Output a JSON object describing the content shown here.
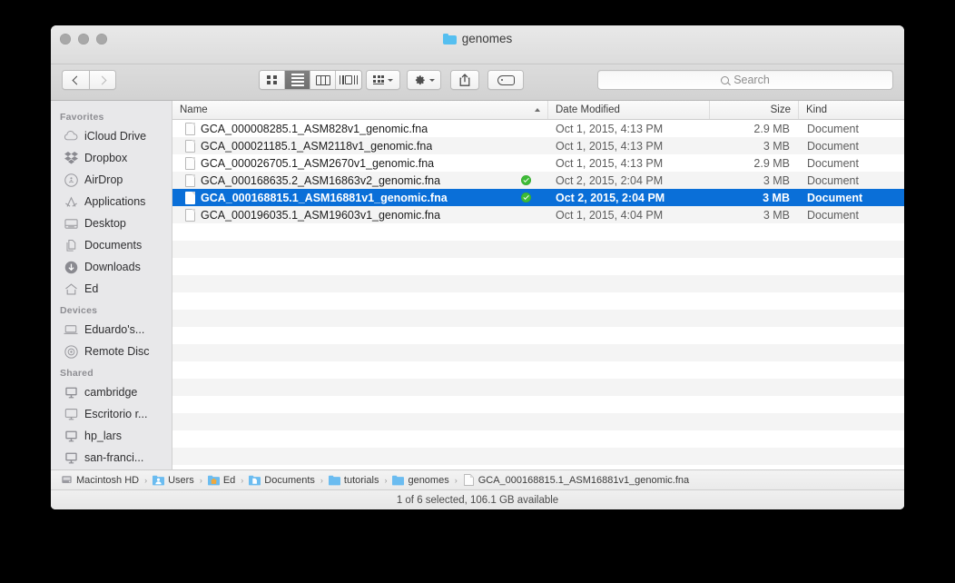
{
  "window": {
    "title": "genomes",
    "traffic_lights": [
      "close-button",
      "minimize-button",
      "zoom-button"
    ]
  },
  "toolbar": {
    "back_label": "Back",
    "forward_label": "Forward",
    "terminal_folder_label": ">_...",
    "view_modes": [
      {
        "name": "icon-view",
        "selected": false
      },
      {
        "name": "list-view",
        "selected": true
      },
      {
        "name": "column-view",
        "selected": false
      },
      {
        "name": "coverflow-view",
        "selected": false
      }
    ],
    "arrange_label": "Arrange",
    "action_label": "Action",
    "share_label": "Share",
    "tag_label": "Edit Tags"
  },
  "search": {
    "placeholder": "Search",
    "value": ""
  },
  "sidebar": {
    "sections": [
      {
        "title": "Favorites",
        "items": [
          {
            "label": "iCloud Drive",
            "icon": "cloud-icon"
          },
          {
            "label": "Dropbox",
            "icon": "dropbox-icon"
          },
          {
            "label": "AirDrop",
            "icon": "airdrop-icon"
          },
          {
            "label": "Applications",
            "icon": "applications-icon"
          },
          {
            "label": "Desktop",
            "icon": "desktop-icon"
          },
          {
            "label": "Documents",
            "icon": "documents-icon"
          },
          {
            "label": "Downloads",
            "icon": "downloads-icon"
          },
          {
            "label": "Ed",
            "icon": "home-icon"
          }
        ]
      },
      {
        "title": "Devices",
        "items": [
          {
            "label": "Eduardo's...",
            "icon": "laptop-icon"
          },
          {
            "label": "Remote Disc",
            "icon": "disc-icon"
          }
        ]
      },
      {
        "title": "Shared",
        "items": [
          {
            "label": "cambridge",
            "icon": "display-icon"
          },
          {
            "label": "Escritorio r...",
            "icon": "display-icon"
          },
          {
            "label": "hp_lars",
            "icon": "display-icon"
          },
          {
            "label": "san-franci...",
            "icon": "display-icon"
          }
        ]
      }
    ]
  },
  "file_list": {
    "columns": [
      "Name",
      "Date Modified",
      "Size",
      "Kind"
    ],
    "sort_column": "Name",
    "sort_direction": "ascending",
    "rows": [
      {
        "name": "GCA_000008285.1_ASM828v1_genomic.fna",
        "date": "Oct 1, 2015, 4:13 PM",
        "size": "2.9 MB",
        "kind": "Document",
        "tagged": false,
        "selected": false
      },
      {
        "name": "GCA_000021185.1_ASM2118v1_genomic.fna",
        "date": "Oct 1, 2015, 4:13 PM",
        "size": "3 MB",
        "kind": "Document",
        "tagged": false,
        "selected": false
      },
      {
        "name": "GCA_000026705.1_ASM2670v1_genomic.fna",
        "date": "Oct 1, 2015, 4:13 PM",
        "size": "2.9 MB",
        "kind": "Document",
        "tagged": false,
        "selected": false
      },
      {
        "name": "GCA_000168635.2_ASM16863v2_genomic.fna",
        "date": "Oct 2, 2015, 2:04 PM",
        "size": "3 MB",
        "kind": "Document",
        "tagged": true,
        "selected": false
      },
      {
        "name": "GCA_000168815.1_ASM16881v1_genomic.fna",
        "date": "Oct 2, 2015, 2:04 PM",
        "size": "3 MB",
        "kind": "Document",
        "tagged": true,
        "selected": true
      },
      {
        "name": "GCA_000196035.1_ASM19603v1_genomic.fna",
        "date": "Oct 1, 2015, 4:04 PM",
        "size": "3 MB",
        "kind": "Document",
        "tagged": false,
        "selected": false
      }
    ]
  },
  "path_bar": {
    "segments": [
      {
        "label": "Macintosh HD",
        "icon": "harddisk-icon"
      },
      {
        "label": "Users",
        "icon": "users-folder-icon"
      },
      {
        "label": "Ed",
        "icon": "home-folder-icon"
      },
      {
        "label": "Documents",
        "icon": "documents-folder-icon"
      },
      {
        "label": "tutorials",
        "icon": "folder-icon"
      },
      {
        "label": "genomes",
        "icon": "folder-icon"
      },
      {
        "label": "GCA_000168815.1_ASM16881v1_genomic.fna",
        "icon": "document-icon"
      }
    ],
    "separator": "›"
  },
  "status_bar": {
    "text": "1 of 6 selected, 106.1 GB available"
  },
  "colors": {
    "selection_blue": "#0a6fd8",
    "tag_green": "#3dbb36",
    "folder_blue": "#55bff0",
    "alt_row": "#f4f4f4"
  }
}
